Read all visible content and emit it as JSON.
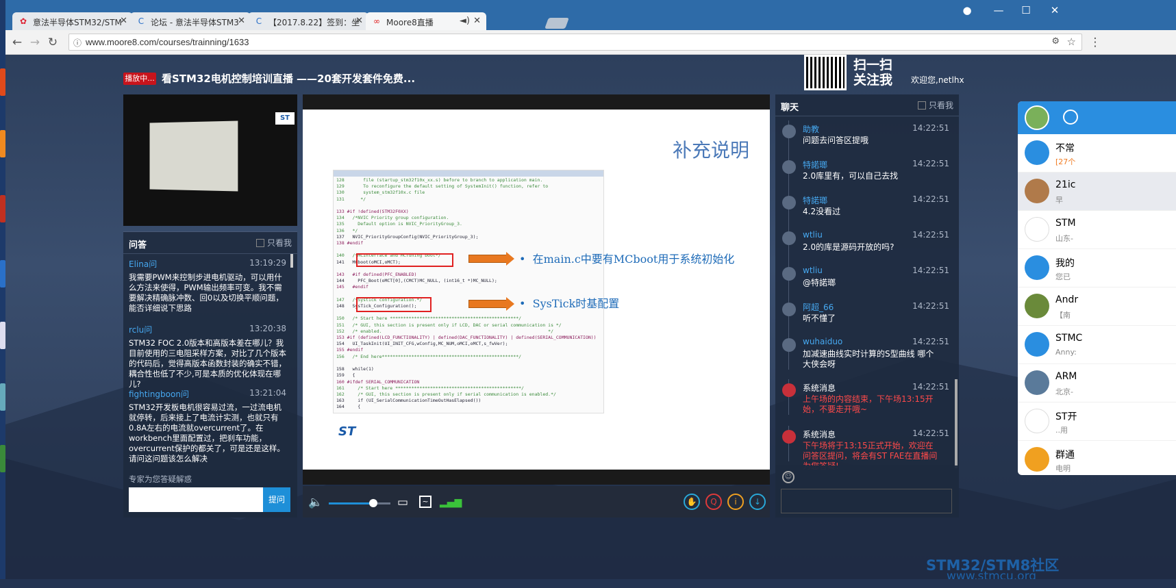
{
  "browser": {
    "tabs": [
      {
        "label": "意法半导体STM32/STM"
      },
      {
        "label": "论坛 - 意法半导体STM3"
      },
      {
        "label": "【2017.8.22】签到：坐"
      },
      {
        "label": "Moore8直播"
      }
    ],
    "url": "www.moore8.com/courses/trainning/1633"
  },
  "header": {
    "live_badge": "播放中...",
    "title": "看STM32电机控制培训直播 ——20套开发套件免费...",
    "qr_line1": "扫一扫",
    "qr_line2": "关注我",
    "welcome": "欢迎您,netlhx"
  },
  "qa": {
    "title": "问答",
    "only_me": "只看我",
    "items": [
      {
        "user": "Elina问",
        "time": "13:19:29",
        "text": "我需要PWM来控制步进电机驱动，可以用什么方法来使得，PWM输出频率可变。我不需要解决精确脉冲数、回0以及切换平顺问题，能否详细说下思路"
      },
      {
        "user": "rclu问",
        "time": "13:20:38",
        "text": "STM32 FOC 2.0版本和高版本差在哪儿？我目前使用的三电阻采样方案，对比了几个版本的代码后，觉得高版本函数封装的确实不错，耦合性也低了不少,可是本质的优化体现在哪儿?"
      },
      {
        "user": "fightingboon问",
        "time": "13:21:04",
        "text": "STM32开发板电机很容易过流，一过流电机就停转，后来接上了电流计实测，也就只有0.8A左右的电流就overcurrent了。在workbench里面配置过，把刹车功能，overcurrent保护的都关了，可是还是这样。请问这问题该怎么解决"
      }
    ],
    "footer_label": "专家为您答疑解惑",
    "submit": "提问"
  },
  "slide": {
    "title": "补充说明",
    "bullet1": "在main.c中要有MCboot用于系统初始化",
    "bullet2": "SysTick时基配置",
    "logo": "ST"
  },
  "player": {
    "volume": 0.72
  },
  "chat": {
    "title": "聊天",
    "only_me": "只看我",
    "items": [
      {
        "user": "助教",
        "time": "14:22:51",
        "text": "问题去问答区提哦",
        "sys": false
      },
      {
        "user": "特諾瑯",
        "time": "14:22:51",
        "text": "2.0库里有，可以自己去找",
        "sys": false
      },
      {
        "user": "特諾瑯",
        "time": "14:22:51",
        "text": "4.2没看过",
        "sys": false
      },
      {
        "user": "wtliu",
        "time": "14:22:51",
        "text": "2.0的库是源码开放的吗?",
        "sys": false
      },
      {
        "user": "wtliu",
        "time": "14:22:51",
        "text": "@特諾瑯",
        "sys": false
      },
      {
        "user": "阿超_66",
        "time": "14:22:51",
        "text": "听不懂了",
        "sys": false
      },
      {
        "user": "wuhaiduo",
        "time": "14:22:51",
        "text": "加减速曲线实时计算的S型曲线 哪个大侠会呀",
        "sys": false
      },
      {
        "user": "系统消息",
        "time": "14:22:51",
        "text": "上午场的内容结束，下午场13:15开始，不要走开哦~",
        "sys": true
      },
      {
        "user": "系统消息",
        "time": "14:22:51",
        "text": "下午场将于13:15正式开始，欢迎在问答区提问，将会有ST FAE在直播间为您答疑!",
        "sys": true
      }
    ]
  },
  "watermark": {
    "line1": "STM32/STM8社区",
    "line2": "www.stmcu.org"
  },
  "side_panel": {
    "items": [
      {
        "name": "不常",
        "sub": "[27个"
      },
      {
        "name": "21ic",
        "sub": "早"
      },
      {
        "name": "STM",
        "sub": "山东-"
      },
      {
        "name": "我的",
        "sub": "您已"
      },
      {
        "name": "Andr",
        "sub": "【南"
      },
      {
        "name": "STMC",
        "sub": "Anny:"
      },
      {
        "name": "ARM",
        "sub": "北京-"
      },
      {
        "name": "ST开",
        "sub": "..用"
      },
      {
        "name": "群通",
        "sub": "电明"
      }
    ]
  }
}
